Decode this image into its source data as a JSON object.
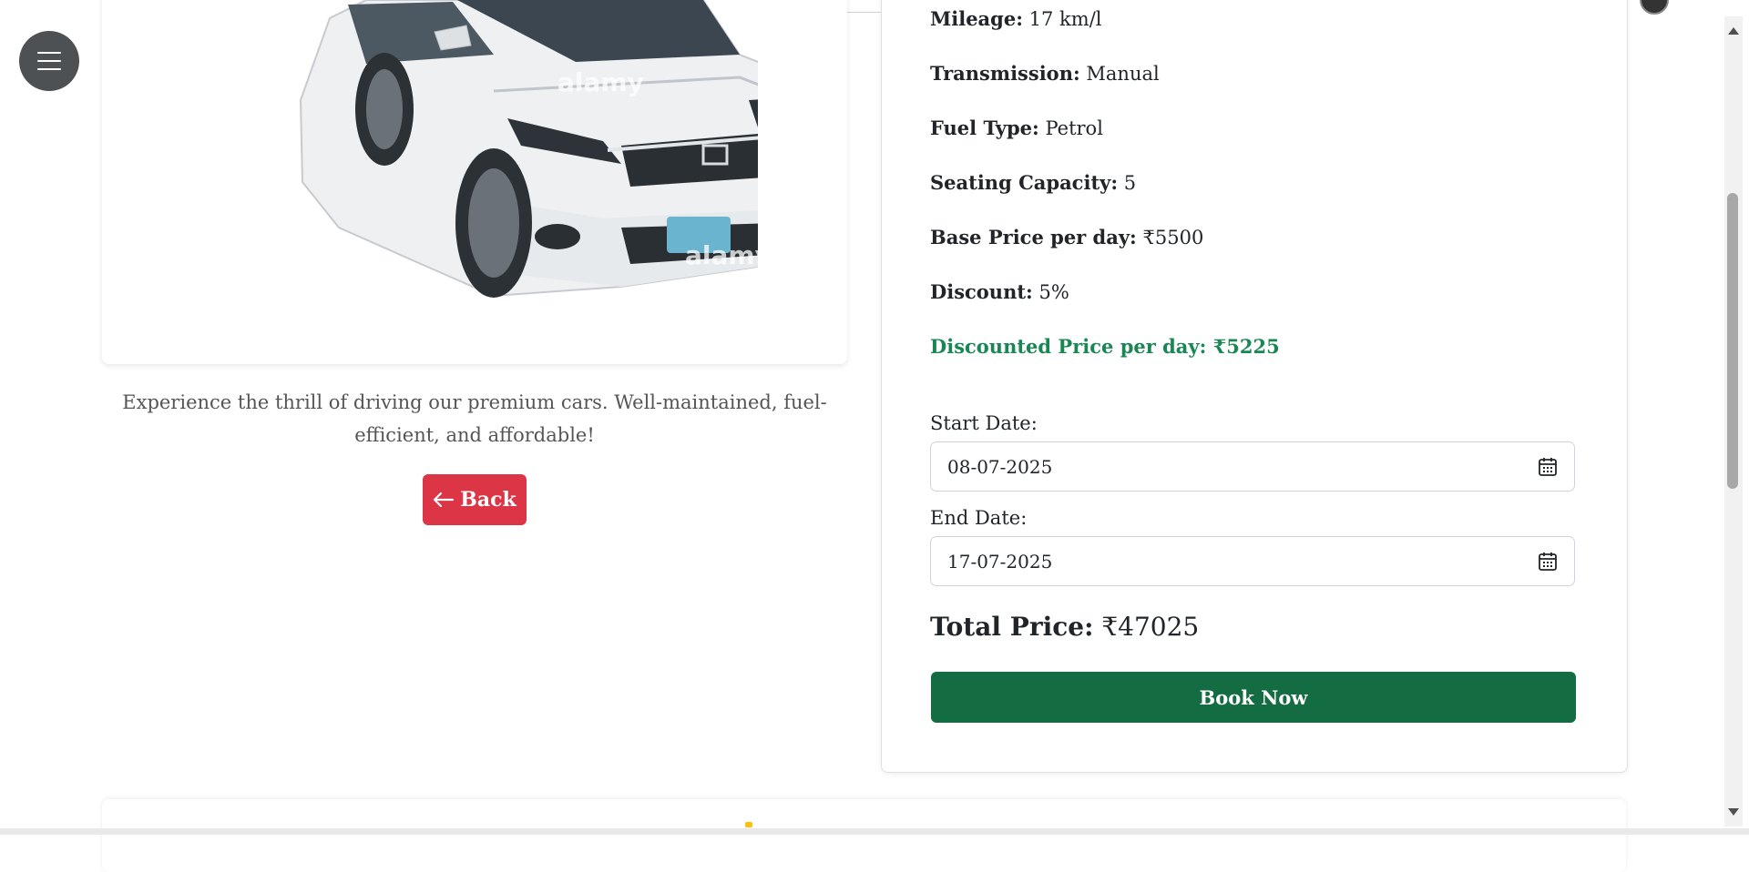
{
  "specs": {
    "mileage_label": "Mileage:",
    "mileage_value": "17 km/l",
    "transmission_label": "Transmission:",
    "transmission_value": "Manual",
    "fuel_label": "Fuel Type:",
    "fuel_value": "Petrol",
    "seating_label": "Seating Capacity:",
    "seating_value": "5",
    "base_label": "Base Price per day:",
    "base_value": "₹5500",
    "discount_label": "Discount:",
    "discount_value": "5%",
    "discounted_text": "Discounted Price per day: ₹5225"
  },
  "booking": {
    "start_label": "Start Date:",
    "start_value": "08-07-2025",
    "end_label": "End Date:",
    "end_value": "17-07-2025",
    "total_label": "Total Price:",
    "total_value": "₹47025",
    "book_label": "Book Now"
  },
  "car": {
    "description": "Experience the thrill of driving our premium cars. Well-maintained, fuel-efficient, and affordable!",
    "back_label": "Back",
    "watermark": "alamy"
  },
  "icons": {
    "menu": "hamburger-menu-icon",
    "back": "arrow-left-icon",
    "calendar": "calendar-icon"
  },
  "colors": {
    "back_button": "#dc3545",
    "book_button": "#146c43",
    "discounted_text": "#198754",
    "menu_button": "#4d5154"
  }
}
